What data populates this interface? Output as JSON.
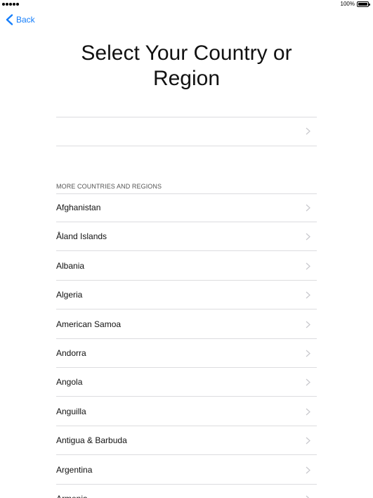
{
  "status_bar": {
    "battery_text": "100%"
  },
  "nav": {
    "back_label": "Back",
    "accent_color": "#157efb"
  },
  "title": "Select Your Country or Region",
  "section_header": "MORE COUNTRIES AND REGIONS",
  "countries": [
    "Afghanistan",
    "Åland Islands",
    "Albania",
    "Algeria",
    "American Samoa",
    "Andorra",
    "Angola",
    "Anguilla",
    "Antigua & Barbuda",
    "Argentina",
    "Armenia"
  ]
}
